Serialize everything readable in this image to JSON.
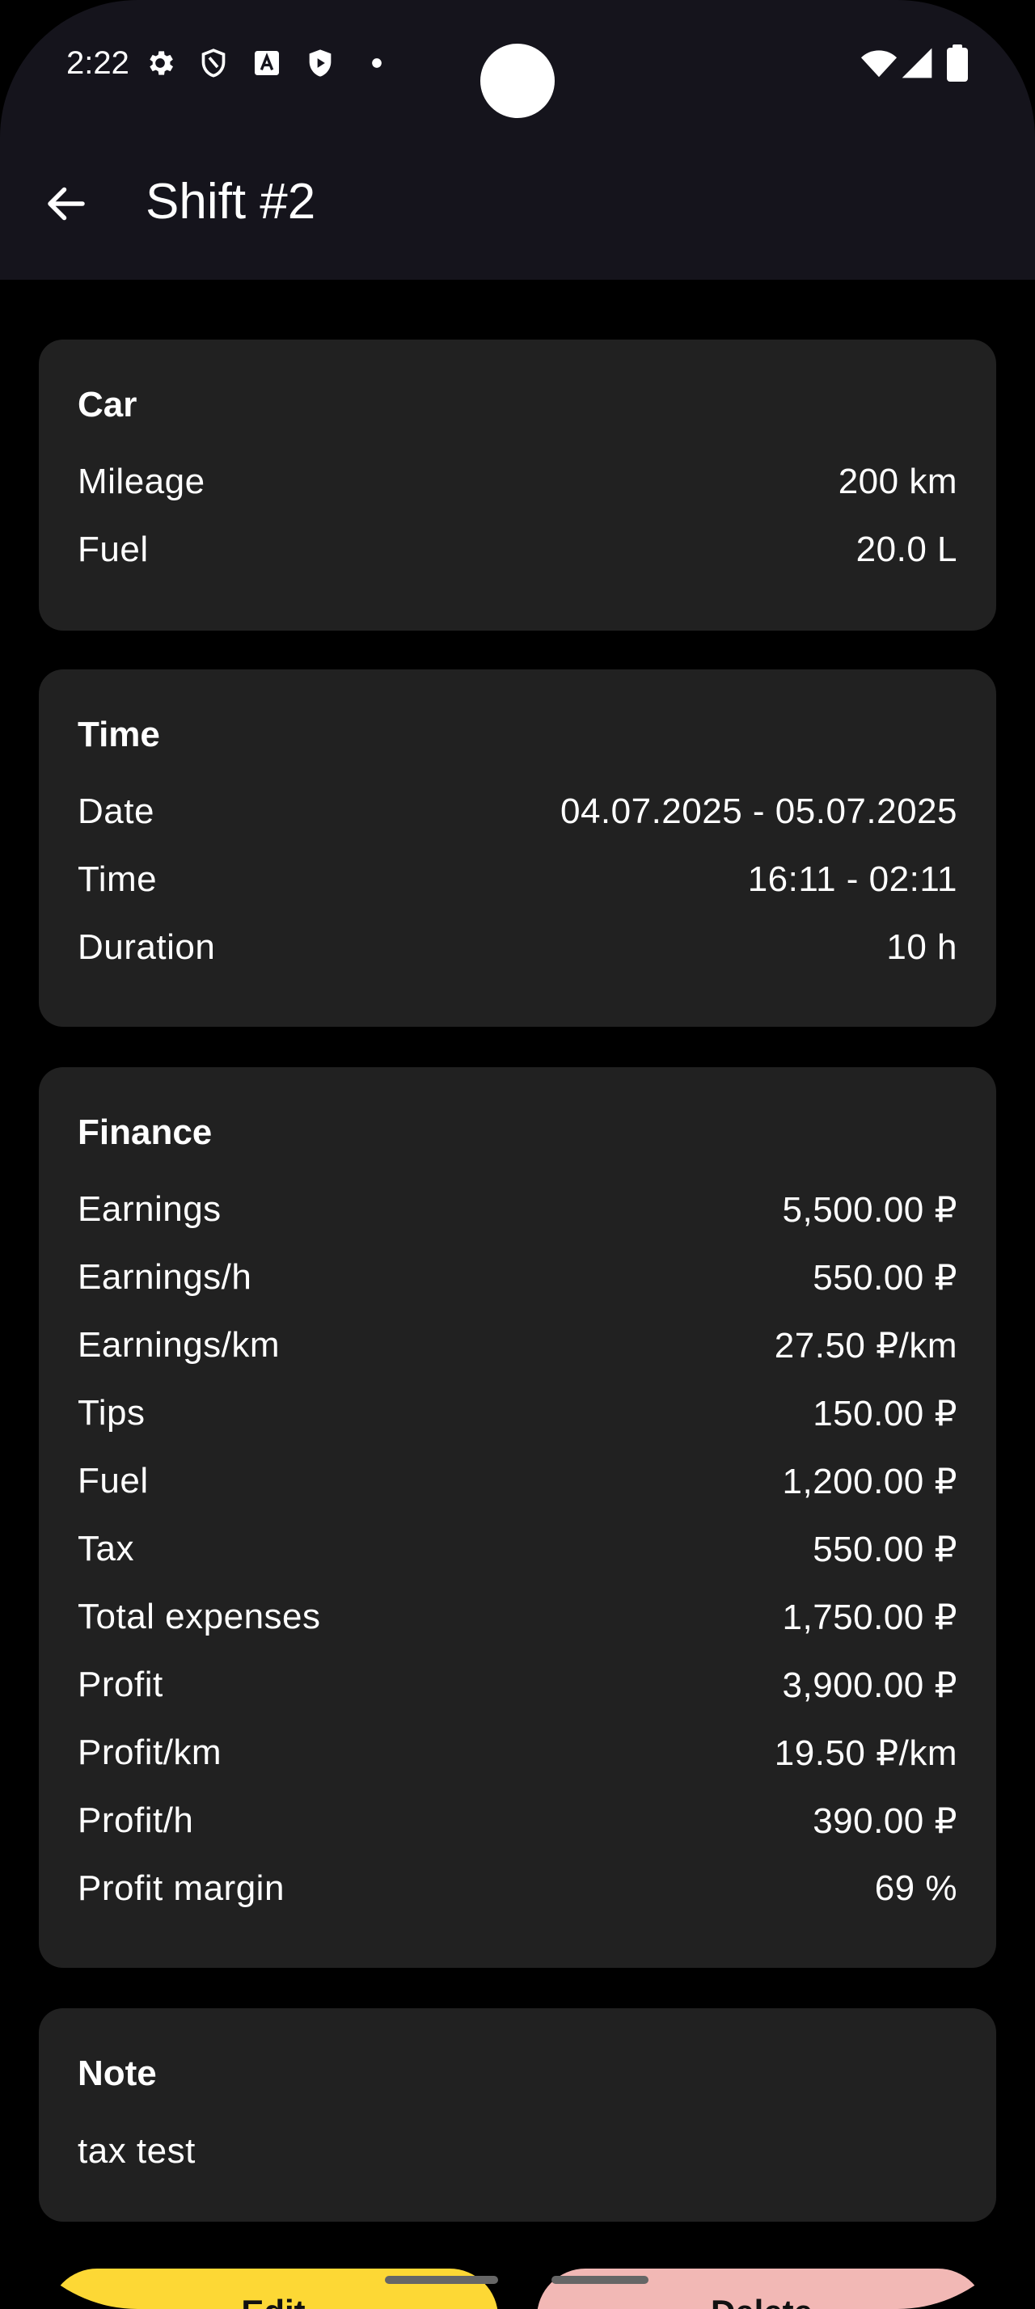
{
  "status_bar": {
    "time": "2:22",
    "icons_left": [
      "gear-icon",
      "shield-icon",
      "font-a-icon",
      "play-protect-icon",
      "dot-icon"
    ],
    "icons_right": [
      "wifi-icon",
      "signal-icon",
      "battery-icon"
    ]
  },
  "app_bar": {
    "title": "Shift #2",
    "back_icon": "arrow-back-icon"
  },
  "car": {
    "title": "Car",
    "rows": [
      {
        "label": "Mileage",
        "value": "200 km"
      },
      {
        "label": "Fuel",
        "value": "20.0 L"
      }
    ]
  },
  "time": {
    "title": "Time",
    "rows": [
      {
        "label": "Date",
        "value": "04.07.2025 - 05.07.2025"
      },
      {
        "label": "Time",
        "value": "16:11 - 02:11"
      },
      {
        "label": "Duration",
        "value": "10 h"
      }
    ]
  },
  "finance": {
    "title": "Finance",
    "rows": [
      {
        "label": "Earnings",
        "value": "5,500.00 ₽"
      },
      {
        "label": "Earnings/h",
        "value": "550.00 ₽"
      },
      {
        "label": "Earnings/km",
        "value": "27.50 ₽/km"
      },
      {
        "label": "Tips",
        "value": "150.00 ₽"
      },
      {
        "label": "Fuel",
        "value": "1,200.00 ₽"
      },
      {
        "label": "Tax",
        "value": "550.00 ₽"
      },
      {
        "label": "Total expenses",
        "value": "1,750.00 ₽"
      },
      {
        "label": "Profit",
        "value": "3,900.00 ₽"
      },
      {
        "label": "Profit/km",
        "value": "19.50 ₽/km"
      },
      {
        "label": "Profit/h",
        "value": "390.00 ₽"
      },
      {
        "label": "Profit margin",
        "value": "69 %"
      }
    ]
  },
  "note": {
    "title": "Note",
    "text": "tax test"
  },
  "actions": {
    "edit_label": "Edit",
    "delete_label": "Delete"
  },
  "colors": {
    "app_bar_bg": "#15141c",
    "card_bg": "#212121",
    "edit_button": "#fdd835",
    "delete_button": "#f2b8b5"
  }
}
